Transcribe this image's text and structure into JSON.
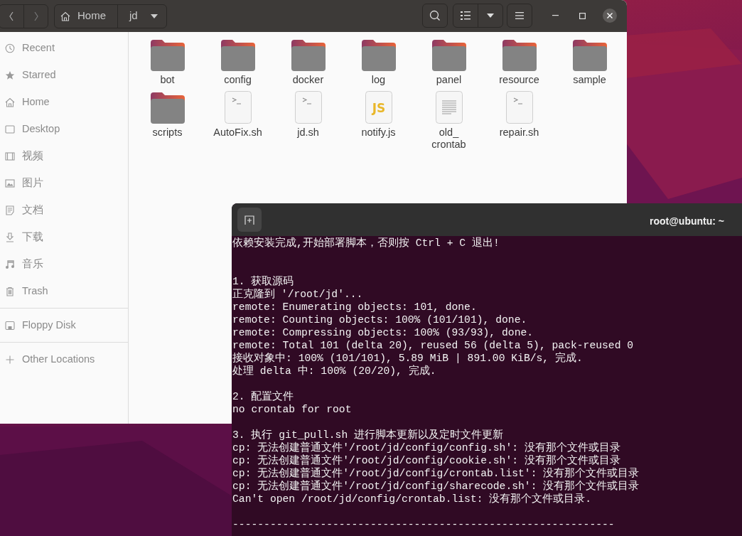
{
  "files_window": {
    "path": [
      {
        "label": "Home"
      },
      {
        "label": "jd"
      }
    ],
    "sidebar": {
      "groups": [
        {
          "items": [
            {
              "label": "Recent"
            },
            {
              "label": "Starred"
            },
            {
              "label": "Home"
            },
            {
              "label": "Desktop"
            },
            {
              "label": "视频"
            },
            {
              "label": "图片"
            },
            {
              "label": "文档"
            },
            {
              "label": "下载"
            },
            {
              "label": "音乐"
            },
            {
              "label": "Trash"
            }
          ]
        },
        {
          "items": [
            {
              "label": "Floppy Disk"
            }
          ]
        },
        {
          "items": [
            {
              "label": "Other Locations"
            }
          ]
        }
      ]
    },
    "files": [
      {
        "name": "bot",
        "kind": "folder"
      },
      {
        "name": "config",
        "kind": "folder"
      },
      {
        "name": "docker",
        "kind": "folder"
      },
      {
        "name": "log",
        "kind": "folder"
      },
      {
        "name": "panel",
        "kind": "folder"
      },
      {
        "name": "resource",
        "kind": "folder"
      },
      {
        "name": "sample",
        "kind": "folder"
      },
      {
        "name": "scripts",
        "kind": "folder"
      },
      {
        "name": "AutoFix.sh",
        "kind": "script"
      },
      {
        "name": "jd.sh",
        "kind": "script"
      },
      {
        "name": "notify.js",
        "kind": "js",
        "icon_text": "JS"
      },
      {
        "name": "old_\ncrontab",
        "kind": "text"
      },
      {
        "name": "repair.sh",
        "kind": "script"
      }
    ]
  },
  "terminal": {
    "title": "root@ubuntu: ~",
    "blocks": [
      {
        "lines": [
          "依赖安装完成,开始部署脚本，否则按 Ctrl + C 退出!"
        ]
      },
      {
        "lines": [
          "1. 获取源码",
          "正克隆到 '/root/jd'...",
          "remote: Enumerating objects: 101, done.",
          "remote: Counting objects: 100% (101/101), done.",
          "remote: Compressing objects: 100% (93/93), done.",
          "remote: Total 101 (delta 20), reused 56 (delta 5), pack-reused 0",
          "接收对象中: 100% (101/101), 5.89 MiB | 891.00 KiB/s, 完成.",
          "处理 delta 中: 100% (20/20), 完成."
        ]
      },
      {
        "lines": [
          "2. 配置文件",
          "no crontab for root"
        ]
      },
      {
        "lines": [
          "3. 执行 git_pull.sh 进行脚本更新以及定时文件更新",
          "cp: 无法创建普通文件'/root/jd/config/config.sh': 没有那个文件或目录",
          "cp: 无法创建普通文件'/root/jd/config/cookie.sh': 没有那个文件或目录",
          "cp: 无法创建普通文件'/root/jd/config/crontab.list': 没有那个文件或目录",
          "cp: 无法创建普通文件'/root/jd/config/sharecode.sh': 没有那个文件或目录",
          "Can't open /root/jd/config/crontab.list: 没有那个文件或目录."
        ]
      },
      {
        "lines": [
          "-------------------------------------------------------------"
        ]
      }
    ]
  }
}
